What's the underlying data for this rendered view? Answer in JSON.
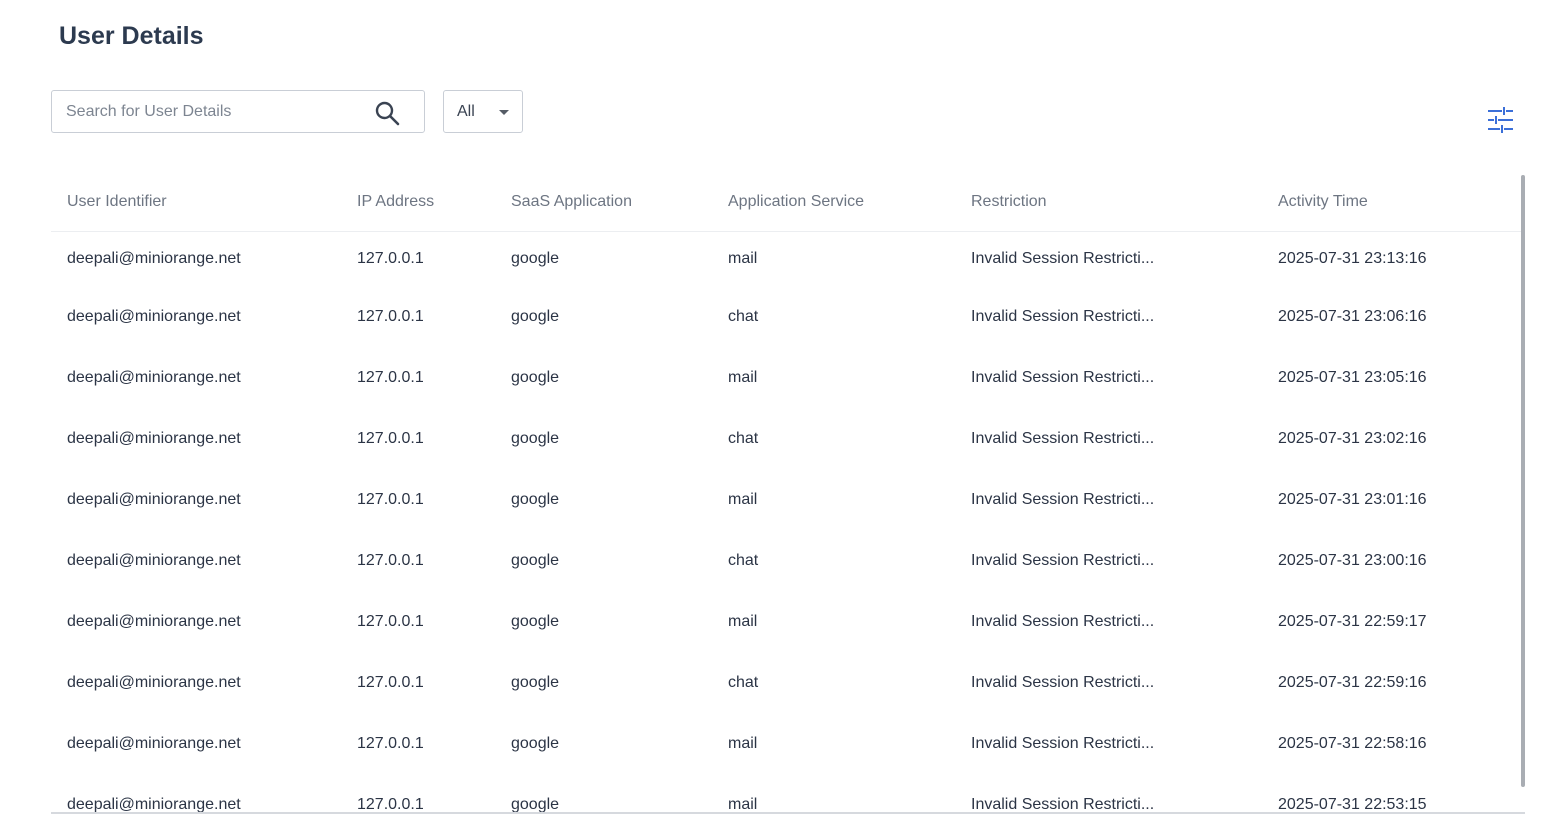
{
  "header": {
    "title": "User Details"
  },
  "search": {
    "placeholder": "Search for User Details",
    "value": ""
  },
  "filter": {
    "selected": "All"
  },
  "icons": {
    "search": "search-icon",
    "columns": "sliders-icon",
    "caret": "caret-down-icon"
  },
  "colors": {
    "accent": "#3b6fd8",
    "title": "#2c3a4f",
    "header_text": "#6d7582"
  },
  "table": {
    "columns": [
      "User Identifier",
      "IP Address",
      "SaaS Application",
      "Application Service",
      "Restriction",
      "Activity Time"
    ],
    "rows": [
      [
        "deepali@miniorange.net",
        "127.0.0.1",
        "google",
        "mail",
        "Invalid Session Restricti...",
        "2025-07-31 23:13:16"
      ],
      [
        "deepali@miniorange.net",
        "127.0.0.1",
        "google",
        "chat",
        "Invalid Session Restricti...",
        "2025-07-31 23:06:16"
      ],
      [
        "deepali@miniorange.net",
        "127.0.0.1",
        "google",
        "mail",
        "Invalid Session Restricti...",
        "2025-07-31 23:05:16"
      ],
      [
        "deepali@miniorange.net",
        "127.0.0.1",
        "google",
        "chat",
        "Invalid Session Restricti...",
        "2025-07-31 23:02:16"
      ],
      [
        "deepali@miniorange.net",
        "127.0.0.1",
        "google",
        "mail",
        "Invalid Session Restricti...",
        "2025-07-31 23:01:16"
      ],
      [
        "deepali@miniorange.net",
        "127.0.0.1",
        "google",
        "chat",
        "Invalid Session Restricti...",
        "2025-07-31 23:00:16"
      ],
      [
        "deepali@miniorange.net",
        "127.0.0.1",
        "google",
        "mail",
        "Invalid Session Restricti...",
        "2025-07-31 22:59:17"
      ],
      [
        "deepali@miniorange.net",
        "127.0.0.1",
        "google",
        "chat",
        "Invalid Session Restricti...",
        "2025-07-31 22:59:16"
      ],
      [
        "deepali@miniorange.net",
        "127.0.0.1",
        "google",
        "mail",
        "Invalid Session Restricti...",
        "2025-07-31 22:58:16"
      ],
      [
        "deepali@miniorange.net",
        "127.0.0.1",
        "google",
        "mail",
        "Invalid Session Restricti...",
        "2025-07-31 22:53:15"
      ]
    ]
  }
}
